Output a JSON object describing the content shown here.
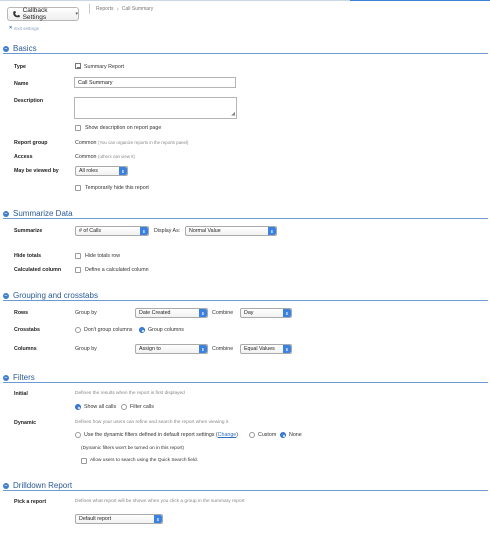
{
  "header": {
    "app_button_label": "Callback Settings",
    "crumbs": [
      "Reports",
      "Call Summary"
    ],
    "exit_label": "Exit settings"
  },
  "basics": {
    "section_title": "Basics",
    "type_label": "Type",
    "type_value": "Summary Report",
    "name_label": "Name",
    "name_value": "Call Summary",
    "description_label": "Description",
    "description_value": "",
    "show_description_label": "Show description on report page",
    "report_group_label": "Report group",
    "report_group_value": "Common",
    "report_group_note": "(You can organize reports in the reports panel)",
    "access_label": "Access",
    "access_value": "Common",
    "access_note": "(others can view it)",
    "viewed_by_label": "May be viewed by",
    "viewed_by_value": "All roles",
    "hide_report_label": "Temporarily hide this report"
  },
  "summarize": {
    "section_title": "Summarize Data",
    "summarize_label": "Summarize",
    "summarize_value": "# of Calls",
    "display_as_label": "Display As:",
    "display_as_value": "Normal Value",
    "hide_totals_label": "Hide totals",
    "hide_totals_option": "Hide totals row",
    "calculated_label": "Calculated column",
    "calculated_option": "Define a calculated column"
  },
  "grouping": {
    "section_title": "Grouping and crosstabs",
    "rows_label": "Rows",
    "rows_group_by": "Group by",
    "rows_field": "Date Created",
    "rows_combine_label": "Combine",
    "rows_combine_value": "Day",
    "crosstabs_label": "Crosstabs",
    "crosstabs_option1": "Don't group columns",
    "crosstabs_option2": "Group columns",
    "columns_label": "Columns",
    "columns_group_by": "Group by",
    "columns_field": "Assign to",
    "columns_combine_label": "Combine",
    "columns_combine_value": "Equal Values"
  },
  "filters": {
    "section_title": "Filters",
    "initial_label": "Initial",
    "initial_desc": "Defines the results when the report is first displayed",
    "initial_option1": "Show all calls",
    "initial_option2": "Filter calls",
    "dynamic_label": "Dynamic",
    "dynamic_desc": "Defines how your users can refine and search the report when viewing it",
    "dynamic_option1_pre": "Use the dynamic filters defined in default report settings (",
    "dynamic_option1_link": "Change",
    "dynamic_option1_post": ")",
    "dynamic_option2": "Custom",
    "dynamic_option3": "None",
    "dynamic_note": "(Dynamic filters won't be turned on in this report)",
    "quick_search_label": "Allow users to search using the Quick Search field."
  },
  "drilldown": {
    "section_title": "Drilldown Report",
    "pick_label": "Pick a report",
    "pick_desc": "Defines what report will be shown when you click a group in the summary report",
    "pick_value": "Default report"
  },
  "icons": {
    "phone": "phone-icon",
    "report": "report-icon"
  },
  "colors": {
    "accent": "#3b82e0",
    "section_title": "#2b5b96",
    "section_rule": "#6c9bd4"
  }
}
